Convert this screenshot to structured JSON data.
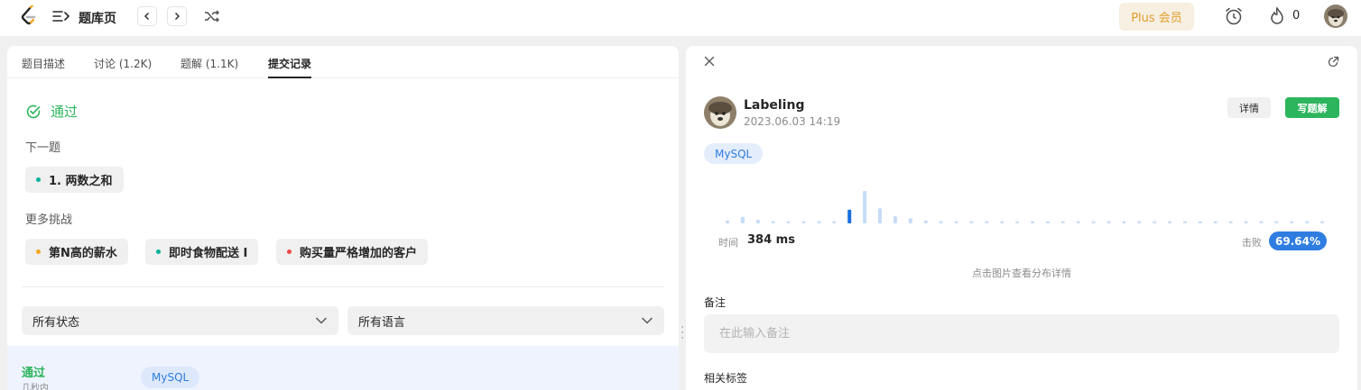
{
  "topbar": {
    "title": "题库页",
    "plus_label": "Plus 会员",
    "streak_count": "0",
    "icons": [
      "leetcode-logo-icon",
      "list-menu-icon",
      "chevron-left-icon",
      "chevron-right-icon",
      "shuffle-icon",
      "alarm-clock-icon",
      "flame-icon"
    ]
  },
  "left": {
    "tabs": [
      "题目描述",
      "讨论 (1.2K)",
      "题解 (1.1K)",
      "提交记录"
    ],
    "active_tab": "提交记录",
    "status": "通过",
    "next_label": "下一题",
    "next_problem": "1. 两数之和",
    "more_label": "更多挑战",
    "challenges": [
      {
        "label": "第N高的薪水",
        "color": "#f5a623"
      },
      {
        "label": "即时食物配送 I",
        "color": "#00af9b"
      },
      {
        "label": "购买量严格增加的客户",
        "color": "#ef4743"
      }
    ],
    "filter_status": "所有状态",
    "filter_language": "所有语言",
    "submission": {
      "status": "通过",
      "time": "几秒内",
      "language": "MySQL"
    }
  },
  "right": {
    "user_name": "Labeling",
    "date": "2023.06.03 14:19",
    "detail_label": "详情",
    "write_label": "写题解",
    "language": "MySQL",
    "time_label": "时间",
    "time_value": "384 ms",
    "beat_label": "击败",
    "beat_value": "69.64%",
    "hint": "点击图片查看分布详情",
    "note_label": "备注",
    "note_placeholder": "在此输入备注",
    "tags_label": "相关标签",
    "distribution": [
      {
        "v": 0.08,
        "c": "light"
      },
      {
        "v": 0.18,
        "c": "light"
      },
      {
        "v": 0.1,
        "c": "light"
      },
      {
        "v": 0.06,
        "c": "light"
      },
      {
        "v": 0.06,
        "c": "light"
      },
      {
        "v": 0.06,
        "c": "light"
      },
      {
        "v": 0.06,
        "c": "light"
      },
      {
        "v": 0.06,
        "c": "light"
      },
      {
        "v": 0.38,
        "c": "active"
      },
      {
        "v": 0.9,
        "c": "light"
      },
      {
        "v": 0.42,
        "c": "light"
      },
      {
        "v": 0.2,
        "c": "light"
      },
      {
        "v": 0.14,
        "c": "light"
      },
      {
        "v": 0.08,
        "c": "light"
      },
      {
        "v": 0.06,
        "c": "light"
      },
      {
        "v": 0.06,
        "c": "light"
      },
      {
        "v": 0.06,
        "c": "light"
      },
      {
        "v": 0.06,
        "c": "light"
      },
      {
        "v": 0.06,
        "c": "light"
      },
      {
        "v": 0.06,
        "c": "light"
      },
      {
        "v": 0.06,
        "c": "light"
      },
      {
        "v": 0.06,
        "c": "light"
      },
      {
        "v": 0.06,
        "c": "light"
      },
      {
        "v": 0.06,
        "c": "light"
      },
      {
        "v": 0.06,
        "c": "light"
      },
      {
        "v": 0.06,
        "c": "light"
      },
      {
        "v": 0.06,
        "c": "light"
      },
      {
        "v": 0.06,
        "c": "light"
      },
      {
        "v": 0.06,
        "c": "light"
      },
      {
        "v": 0.06,
        "c": "light"
      },
      {
        "v": 0.06,
        "c": "light"
      },
      {
        "v": 0.06,
        "c": "light"
      },
      {
        "v": 0.06,
        "c": "light"
      },
      {
        "v": 0.06,
        "c": "light"
      },
      {
        "v": 0.06,
        "c": "light"
      },
      {
        "v": 0.06,
        "c": "light"
      },
      {
        "v": 0.06,
        "c": "light"
      },
      {
        "v": 0.06,
        "c": "light"
      },
      {
        "v": 0.06,
        "c": "light"
      },
      {
        "v": 0.06,
        "c": "light"
      }
    ],
    "colors": {
      "light": "#c7dcf7",
      "active": "#1a6fe0"
    }
  }
}
